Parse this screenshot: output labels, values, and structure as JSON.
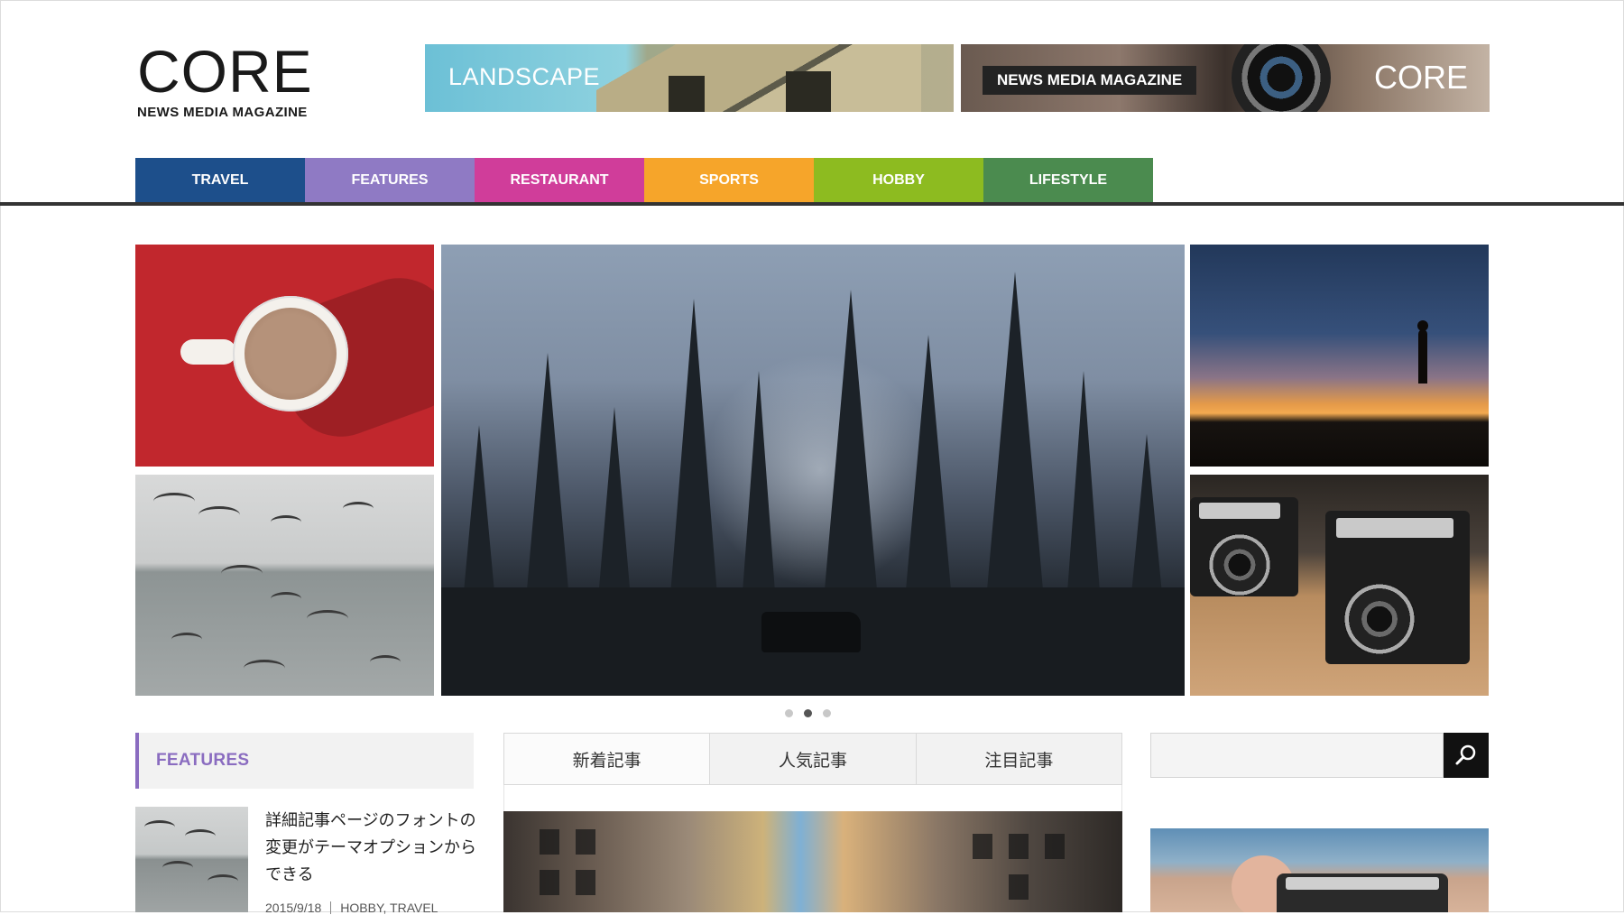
{
  "site": {
    "logo_title": "CORE",
    "logo_subtitle": "NEWS MEDIA MAGAZINE"
  },
  "banners": {
    "left_label": "LANDSCAPE",
    "right_pill": "NEWS MEDIA MAGAZINE",
    "right_brand": "CORE"
  },
  "categories": [
    {
      "label": "TRAVEL",
      "color": "#1d4f8b"
    },
    {
      "label": "FEATURES",
      "color": "#8f7ac4"
    },
    {
      "label": "RESTAURANT",
      "color": "#d03d9a"
    },
    {
      "label": "SPORTS",
      "color": "#f6a52a"
    },
    {
      "label": "HOBBY",
      "color": "#8dbb20"
    },
    {
      "label": "LIFESTYLE",
      "color": "#4b8b4f"
    }
  ],
  "slider": {
    "dot_count": 3,
    "active_index": 1
  },
  "features": {
    "heading": "FEATURES",
    "accent_color": "#8a6cc0",
    "item": {
      "title": "詳細記事ページのフォントの変更がテーマオプションからできる",
      "date": "2015/9/18",
      "tags": "HOBBY, TRAVEL"
    }
  },
  "tabs": [
    {
      "label": "新着記事"
    },
    {
      "label": "人気記事"
    },
    {
      "label": "注目記事"
    }
  ],
  "search": {
    "value": "",
    "placeholder": ""
  },
  "icons": {
    "search": "magnifier-icon"
  }
}
